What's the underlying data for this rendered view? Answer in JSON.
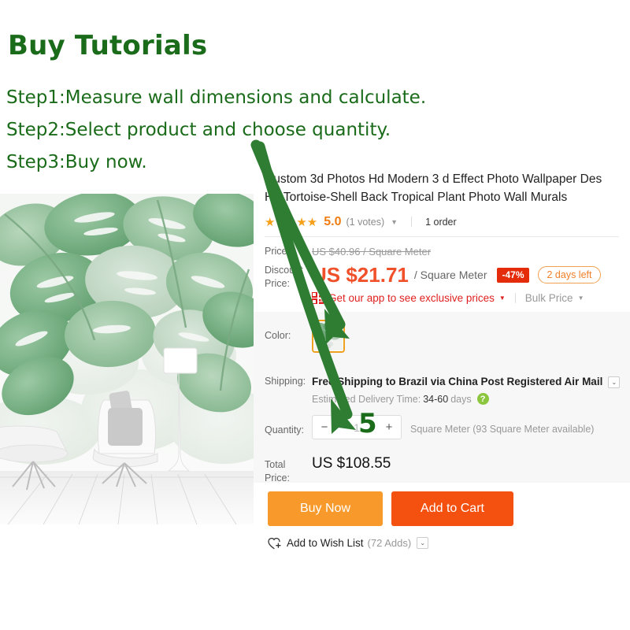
{
  "tutorial": {
    "title": "Buy Tutorials",
    "steps": [
      "Step1:Measure wall dimensions and calculate.",
      "Step2:Select product and choose quantity.",
      "Step3:Buy now."
    ],
    "color": "#1a6b1a"
  },
  "annotations": {
    "quantity_value": "5",
    "arrow_color": "#2e7d32"
  },
  "product": {
    "title_line1": "Custom 3d Photos Hd Modern 3 d Effect Photo Wallpaper Des",
    "title_line2": "Hd Tortoise-Shell Back Tropical Plant Photo Wall Murals",
    "rating": {
      "stars": "★★★★★",
      "score": "5.0",
      "votes": "(1 votes)",
      "chevron": "▼",
      "orders": "1 order"
    },
    "price": {
      "label": "Price:",
      "original": "US $40.96 / Square Meter",
      "discount_label_line1": "Discount",
      "discount_label_line2": "Price:",
      "amount": "US $21.71",
      "unit": "/ Square Meter",
      "discount_badge": "-47%",
      "countdown": "2 days left",
      "app_promo": "Get our app to see exclusive prices",
      "app_chevron": "▼",
      "bulk_price": "Bulk Price",
      "bulk_chevron": "▼",
      "accent": "#f0502a",
      "badge_bg": "#e42c0a"
    },
    "options": {
      "color_label": "Color:",
      "shipping_label": "Shipping:",
      "shipping_value": "Free Shipping to Brazil via China Post Registered Air Mail",
      "shipping_chevron": "⌄",
      "eta_label": "Estimated Delivery Time:",
      "eta_value": "34-60",
      "eta_unit": "days",
      "help_icon": "?",
      "quantity_label": "Quantity:",
      "qty_minus": "−",
      "qty_plus": "+",
      "qty_value": "1",
      "qty_unit": "Square Meter (93 Square Meter available)",
      "total_label": "Total Price:",
      "total_value": "US $108.55"
    },
    "actions": {
      "buy_now": "Buy Now",
      "add_to_cart": "Add to Cart",
      "wish_list": "Add to Wish List",
      "wish_count": "(72 Adds)",
      "wish_chevron": "⌄",
      "buy_color": "#f79a2b",
      "cart_color": "#f4500f"
    }
  }
}
